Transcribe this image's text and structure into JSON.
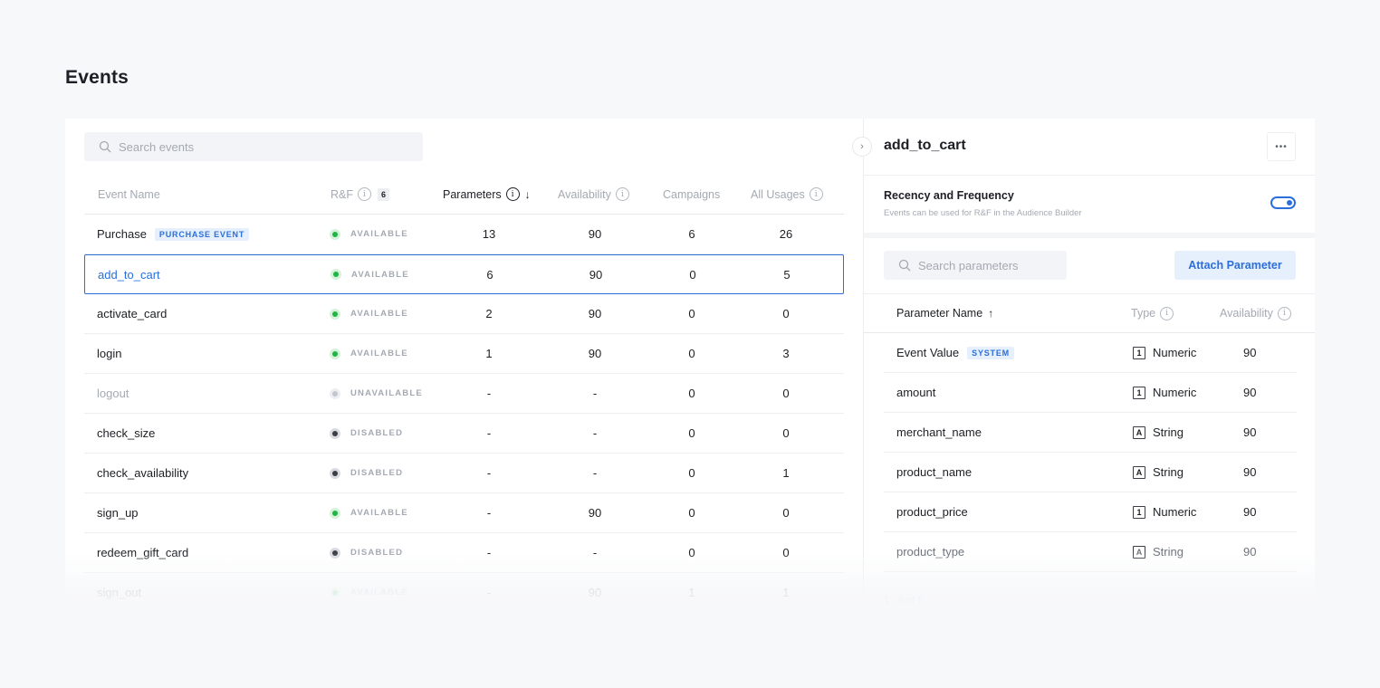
{
  "page": {
    "title": "Events"
  },
  "events_panel": {
    "search_placeholder": "Search events",
    "columns": {
      "name": "Event Name",
      "rf": "R&F",
      "rf_count": "6",
      "parameters": "Parameters",
      "availability": "Availability",
      "campaigns": "Campaigns",
      "all_usages": "All Usages"
    },
    "rows": [
      {
        "name": "Purchase",
        "tag": "PURCHASE EVENT",
        "status": "AVAILABLE",
        "status_kind": "available",
        "parameters": "13",
        "availability": "90",
        "campaigns": "6",
        "usages": "26"
      },
      {
        "name": "add_to_cart",
        "tag": "",
        "status": "AVAILABLE",
        "status_kind": "available",
        "parameters": "6",
        "availability": "90",
        "campaigns": "0",
        "usages": "5",
        "selected": true
      },
      {
        "name": "activate_card",
        "tag": "",
        "status": "AVAILABLE",
        "status_kind": "available",
        "parameters": "2",
        "availability": "90",
        "campaigns": "0",
        "usages": "0"
      },
      {
        "name": "login",
        "tag": "",
        "status": "AVAILABLE",
        "status_kind": "available",
        "parameters": "1",
        "availability": "90",
        "campaigns": "0",
        "usages": "3"
      },
      {
        "name": "logout",
        "tag": "",
        "status": "UNAVAILABLE",
        "status_kind": "unavailable",
        "parameters": "-",
        "availability": "-",
        "campaigns": "0",
        "usages": "0",
        "muted": true
      },
      {
        "name": "check_size",
        "tag": "",
        "status": "DISABLED",
        "status_kind": "disabled",
        "parameters": "-",
        "availability": "-",
        "campaigns": "0",
        "usages": "0"
      },
      {
        "name": "check_availability",
        "tag": "",
        "status": "DISABLED",
        "status_kind": "disabled",
        "parameters": "-",
        "availability": "-",
        "campaigns": "0",
        "usages": "1"
      },
      {
        "name": "sign_up",
        "tag": "",
        "status": "AVAILABLE",
        "status_kind": "available",
        "parameters": "-",
        "availability": "90",
        "campaigns": "0",
        "usages": "0"
      },
      {
        "name": "redeem_gift_card",
        "tag": "",
        "status": "DISABLED",
        "status_kind": "disabled",
        "parameters": "-",
        "availability": "-",
        "campaigns": "0",
        "usages": "0"
      },
      {
        "name": "sign_out",
        "tag": "",
        "status": "AVAILABLE",
        "status_kind": "available",
        "parameters": "-",
        "availability": "90",
        "campaigns": "1",
        "usages": "1"
      }
    ]
  },
  "detail_panel": {
    "title": "add_to_cart",
    "more_label": "•••",
    "rf": {
      "title": "Recency and Frequency",
      "description": "Events can be used for R&F in the Audience Builder",
      "enabled": true
    },
    "search_placeholder": "Search parameters",
    "attach_label": "Attach Parameter",
    "columns": {
      "name": "Parameter Name",
      "type": "Type",
      "availability": "Availability"
    },
    "rows": [
      {
        "name": "Event Value",
        "tag": "SYSTEM",
        "type_icon": "1",
        "type": "Numeric",
        "availability": "90"
      },
      {
        "name": "amount",
        "tag": "",
        "type_icon": "1",
        "type": "Numeric",
        "availability": "90"
      },
      {
        "name": "merchant_name",
        "tag": "",
        "type_icon": "A",
        "type": "String",
        "availability": "90"
      },
      {
        "name": "product_name",
        "tag": "",
        "type_icon": "A",
        "type": "String",
        "availability": "90"
      },
      {
        "name": "product_price",
        "tag": "",
        "type_icon": "1",
        "type": "Numeric",
        "availability": "90"
      },
      {
        "name": "product_type",
        "tag": "",
        "type_icon": "A",
        "type": "String",
        "availability": "90"
      }
    ],
    "pagination": "1 - 6 of 6"
  },
  "colors": {
    "accent": "#2a6fdb",
    "available": "#22b544",
    "disabled": "#3b3e44"
  },
  "icons": {
    "search": "search-icon",
    "info": "info-icon",
    "chevron": "chevron-right-icon"
  }
}
